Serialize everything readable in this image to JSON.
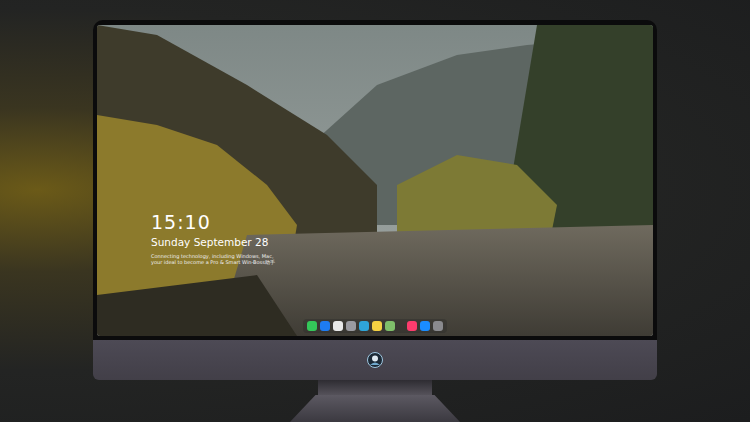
{
  "desktop": {
    "clock": {
      "time": "15:10",
      "date": "Sunday September 28",
      "caption": [
        "Connecting technology, including Windows, Mac,",
        "your ideal to become a Pro & Smart Win-Boss助手"
      ]
    }
  },
  "dock": {
    "groups": [
      {
        "items": [
          {
            "color": "#34c759"
          },
          {
            "color": "#1e7cf2"
          },
          {
            "color": "#e8e8e8"
          },
          {
            "color": "#9a9aa0"
          },
          {
            "color": "#2fa4d8"
          },
          {
            "color": "#f5d142"
          },
          {
            "color": "#7fbf6a"
          }
        ]
      },
      {
        "items": [
          {
            "color": "#fc3c6d"
          },
          {
            "color": "#1a8cff"
          },
          {
            "color": "#8a8a8e"
          }
        ]
      }
    ]
  }
}
